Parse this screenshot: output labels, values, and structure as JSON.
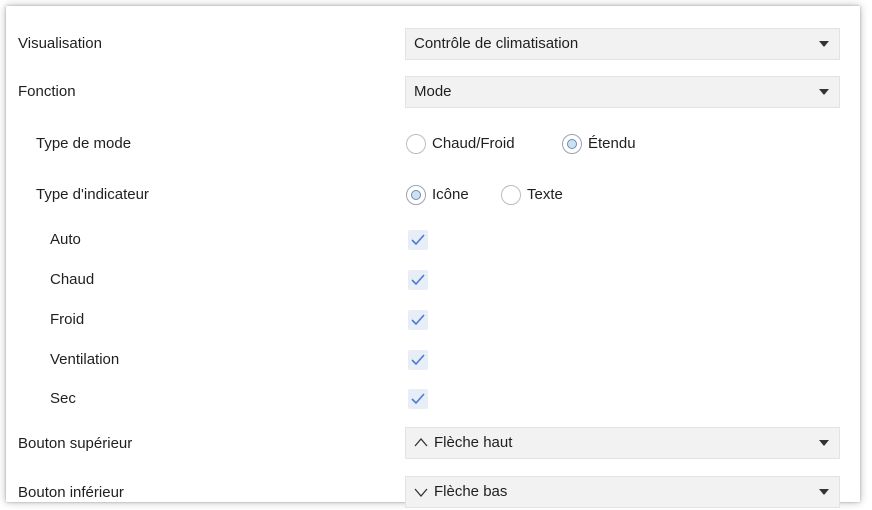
{
  "rows": {
    "visualisation": {
      "label": "Visualisation",
      "value": "Contrôle de climatisation"
    },
    "fonction": {
      "label": "Fonction",
      "value": "Mode"
    },
    "type_mode": {
      "label": "Type de mode",
      "options": [
        "Chaud/Froid",
        "Étendu"
      ],
      "selected": "Étendu"
    },
    "type_indicateur": {
      "label": "Type d'indicateur",
      "options": [
        "Icône",
        "Texte"
      ],
      "selected": "Icône"
    },
    "modes": [
      {
        "label": "Auto",
        "checked": true
      },
      {
        "label": "Chaud",
        "checked": true
      },
      {
        "label": "Froid",
        "checked": true
      },
      {
        "label": "Ventilation",
        "checked": true
      },
      {
        "label": "Sec",
        "checked": true
      }
    ],
    "bouton_superieur": {
      "label": "Bouton supérieur",
      "value": "Flèche haut",
      "icon": "chevron-up-icon"
    },
    "bouton_inferieur": {
      "label": "Bouton inférieur",
      "value": "Flèche bas",
      "icon": "chevron-down-icon"
    }
  },
  "colors": {
    "select_bg": "#f2f2f2",
    "check_bg": "#e8eef8",
    "check_mark": "#4a7bd0",
    "radio_dot": "#cfe0f3"
  }
}
